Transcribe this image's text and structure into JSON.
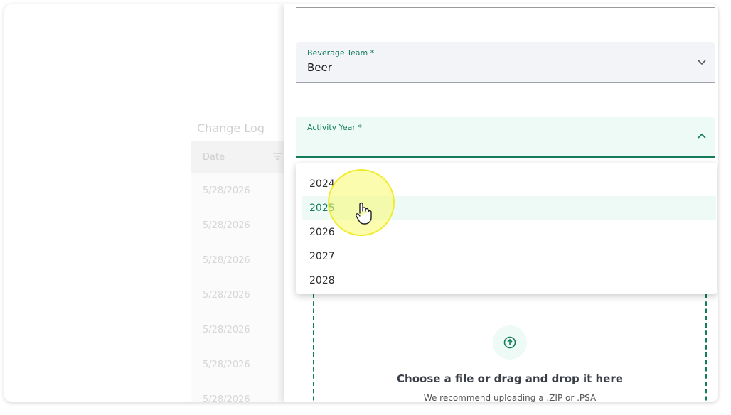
{
  "background": {
    "change_log_title": "Change Log",
    "date_header": "Date",
    "dates": [
      "5/28/2026",
      "5/28/2026",
      "5/28/2026",
      "5/28/2026",
      "5/28/2026",
      "5/28/2026",
      "5/28/2026"
    ]
  },
  "form": {
    "beverage_team": {
      "label": "Beverage Team *",
      "value": "Beer"
    },
    "activity_year": {
      "label": "Activity Year *",
      "value": "",
      "options": [
        "2024",
        "2025",
        "2026",
        "2027",
        "2028"
      ],
      "hovered_option": "2025"
    },
    "upload": {
      "title": "Choose a file or drag and drop it here",
      "subtitle": "We recommend uploading a .ZIP or .PSA"
    }
  },
  "colors": {
    "accent": "#137c5c",
    "accent_bg": "#eefaf5",
    "field_bg": "#f3f4f8"
  },
  "icons": [
    "chevron-down-icon",
    "chevron-up-icon",
    "upload-icon",
    "filter-icon",
    "hand-cursor-icon"
  ]
}
